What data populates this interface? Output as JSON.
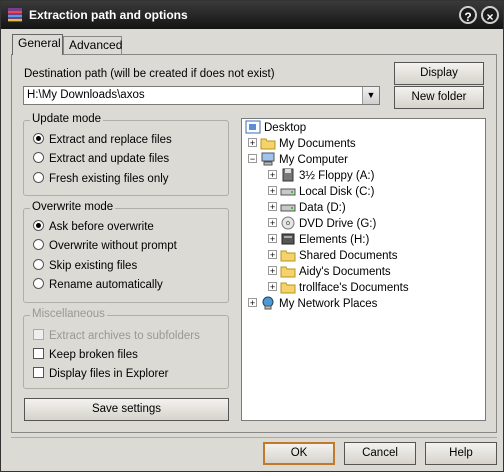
{
  "window": {
    "title": "Extraction path and options",
    "help_glyph": "?",
    "close_glyph": "×"
  },
  "tabs": [
    {
      "label": "General",
      "active": true
    },
    {
      "label": "Advanced",
      "active": false
    }
  ],
  "destination": {
    "label": "Destination path (will be created if does not exist)",
    "value": "H:\\My Downloads\\axos",
    "dropdown_glyph": "▼"
  },
  "buttons": {
    "display": "Display",
    "new_folder": "New folder",
    "save_settings": "Save settings",
    "ok": "OK",
    "cancel": "Cancel",
    "help": "Help"
  },
  "update_mode": {
    "title": "Update mode",
    "options": [
      {
        "label": "Extract and replace files",
        "selected": true
      },
      {
        "label": "Extract and update files",
        "selected": false
      },
      {
        "label": "Fresh existing files only",
        "selected": false
      }
    ]
  },
  "overwrite_mode": {
    "title": "Overwrite mode",
    "options": [
      {
        "label": "Ask before overwrite",
        "selected": true
      },
      {
        "label": "Overwrite without prompt",
        "selected": false
      },
      {
        "label": "Skip existing files",
        "selected": false
      },
      {
        "label": "Rename automatically",
        "selected": false
      }
    ]
  },
  "misc": {
    "title": "Miscellaneous",
    "options": [
      {
        "label": "Extract archives to subfolders",
        "checked": false,
        "disabled": true
      },
      {
        "label": "Keep broken files",
        "checked": false,
        "disabled": false
      },
      {
        "label": "Display files in Explorer",
        "checked": false,
        "disabled": false
      }
    ]
  },
  "tree": [
    {
      "label": "Desktop",
      "icon": "desktop-icon",
      "expander": ""
    },
    {
      "label": "My Documents",
      "icon": "folder-icon",
      "expander": "+"
    },
    {
      "label": "My Computer",
      "icon": "computer-icon",
      "expander": "−"
    },
    {
      "label": "3½ Floppy (A:)",
      "icon": "floppy-icon",
      "expander": "+"
    },
    {
      "label": "Local Disk (C:)",
      "icon": "drive-icon",
      "expander": "+"
    },
    {
      "label": "Data (D:)",
      "icon": "drive-icon",
      "expander": "+"
    },
    {
      "label": "DVD Drive (G:)",
      "icon": "dvd-icon",
      "expander": "+"
    },
    {
      "label": "Elements (H:)",
      "icon": "removable-drive-icon",
      "expander": "+"
    },
    {
      "label": "Shared Documents",
      "icon": "folder-icon",
      "expander": "+"
    },
    {
      "label": "Aidy's Documents",
      "icon": "folder-icon",
      "expander": "+"
    },
    {
      "label": "trollface's Documents",
      "icon": "folder-icon",
      "expander": "+"
    },
    {
      "label": "My Network Places",
      "icon": "network-icon",
      "expander": "+"
    }
  ]
}
